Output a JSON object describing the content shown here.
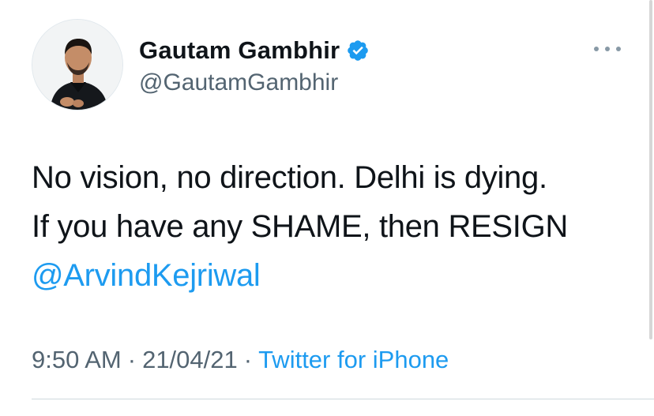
{
  "author": {
    "display_name": "Gautam Gambhir",
    "handle": "@GautamGambhir",
    "verified": true,
    "avatar_icon": "profile-photo"
  },
  "tweet": {
    "line1": "No vision, no direction. Delhi is dying.",
    "line2": "If you have any SHAME, then RESIGN",
    "mention": "@ArvindKejriwal"
  },
  "meta": {
    "time": "9:50 AM",
    "separator": "·",
    "date": "21/04/21",
    "source": "Twitter for iPhone"
  },
  "icons": {
    "verified": "verified-badge-icon",
    "more": "more-options-icon"
  },
  "colors": {
    "link": "#1d9bf0",
    "verified": "#1d9bf0",
    "secondary_text": "#536471",
    "primary_text": "#0f1419"
  }
}
